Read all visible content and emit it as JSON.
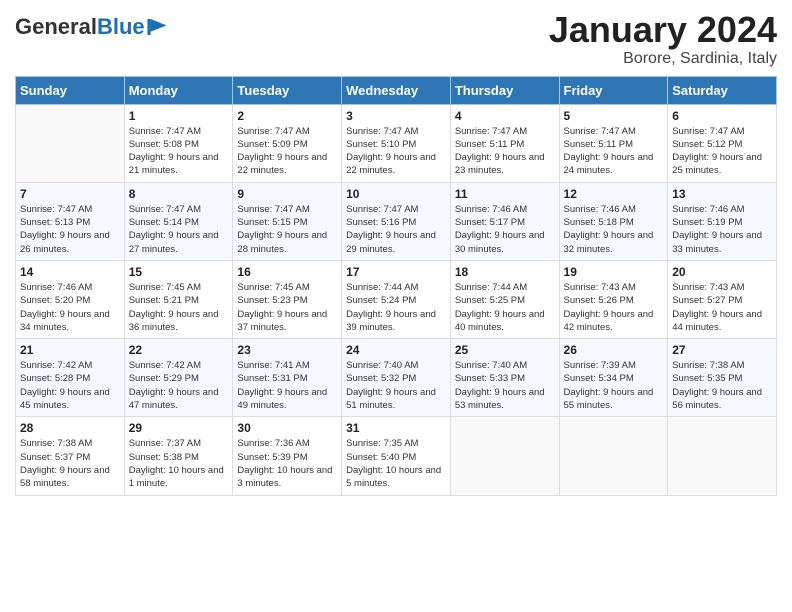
{
  "header": {
    "logo_general": "General",
    "logo_blue": "Blue",
    "month_title": "January 2024",
    "subtitle": "Borore, Sardinia, Italy"
  },
  "days_of_week": [
    "Sunday",
    "Monday",
    "Tuesday",
    "Wednesday",
    "Thursday",
    "Friday",
    "Saturday"
  ],
  "weeks": [
    [
      {
        "day": "",
        "sunrise": "",
        "sunset": "",
        "daylight": ""
      },
      {
        "day": "1",
        "sunrise": "Sunrise: 7:47 AM",
        "sunset": "Sunset: 5:08 PM",
        "daylight": "Daylight: 9 hours and 21 minutes."
      },
      {
        "day": "2",
        "sunrise": "Sunrise: 7:47 AM",
        "sunset": "Sunset: 5:09 PM",
        "daylight": "Daylight: 9 hours and 22 minutes."
      },
      {
        "day": "3",
        "sunrise": "Sunrise: 7:47 AM",
        "sunset": "Sunset: 5:10 PM",
        "daylight": "Daylight: 9 hours and 22 minutes."
      },
      {
        "day": "4",
        "sunrise": "Sunrise: 7:47 AM",
        "sunset": "Sunset: 5:11 PM",
        "daylight": "Daylight: 9 hours and 23 minutes."
      },
      {
        "day": "5",
        "sunrise": "Sunrise: 7:47 AM",
        "sunset": "Sunset: 5:11 PM",
        "daylight": "Daylight: 9 hours and 24 minutes."
      },
      {
        "day": "6",
        "sunrise": "Sunrise: 7:47 AM",
        "sunset": "Sunset: 5:12 PM",
        "daylight": "Daylight: 9 hours and 25 minutes."
      }
    ],
    [
      {
        "day": "7",
        "sunrise": "Sunrise: 7:47 AM",
        "sunset": "Sunset: 5:13 PM",
        "daylight": "Daylight: 9 hours and 26 minutes."
      },
      {
        "day": "8",
        "sunrise": "Sunrise: 7:47 AM",
        "sunset": "Sunset: 5:14 PM",
        "daylight": "Daylight: 9 hours and 27 minutes."
      },
      {
        "day": "9",
        "sunrise": "Sunrise: 7:47 AM",
        "sunset": "Sunset: 5:15 PM",
        "daylight": "Daylight: 9 hours and 28 minutes."
      },
      {
        "day": "10",
        "sunrise": "Sunrise: 7:47 AM",
        "sunset": "Sunset: 5:16 PM",
        "daylight": "Daylight: 9 hours and 29 minutes."
      },
      {
        "day": "11",
        "sunrise": "Sunrise: 7:46 AM",
        "sunset": "Sunset: 5:17 PM",
        "daylight": "Daylight: 9 hours and 30 minutes."
      },
      {
        "day": "12",
        "sunrise": "Sunrise: 7:46 AM",
        "sunset": "Sunset: 5:18 PM",
        "daylight": "Daylight: 9 hours and 32 minutes."
      },
      {
        "day": "13",
        "sunrise": "Sunrise: 7:46 AM",
        "sunset": "Sunset: 5:19 PM",
        "daylight": "Daylight: 9 hours and 33 minutes."
      }
    ],
    [
      {
        "day": "14",
        "sunrise": "Sunrise: 7:46 AM",
        "sunset": "Sunset: 5:20 PM",
        "daylight": "Daylight: 9 hours and 34 minutes."
      },
      {
        "day": "15",
        "sunrise": "Sunrise: 7:45 AM",
        "sunset": "Sunset: 5:21 PM",
        "daylight": "Daylight: 9 hours and 36 minutes."
      },
      {
        "day": "16",
        "sunrise": "Sunrise: 7:45 AM",
        "sunset": "Sunset: 5:23 PM",
        "daylight": "Daylight: 9 hours and 37 minutes."
      },
      {
        "day": "17",
        "sunrise": "Sunrise: 7:44 AM",
        "sunset": "Sunset: 5:24 PM",
        "daylight": "Daylight: 9 hours and 39 minutes."
      },
      {
        "day": "18",
        "sunrise": "Sunrise: 7:44 AM",
        "sunset": "Sunset: 5:25 PM",
        "daylight": "Daylight: 9 hours and 40 minutes."
      },
      {
        "day": "19",
        "sunrise": "Sunrise: 7:43 AM",
        "sunset": "Sunset: 5:26 PM",
        "daylight": "Daylight: 9 hours and 42 minutes."
      },
      {
        "day": "20",
        "sunrise": "Sunrise: 7:43 AM",
        "sunset": "Sunset: 5:27 PM",
        "daylight": "Daylight: 9 hours and 44 minutes."
      }
    ],
    [
      {
        "day": "21",
        "sunrise": "Sunrise: 7:42 AM",
        "sunset": "Sunset: 5:28 PM",
        "daylight": "Daylight: 9 hours and 45 minutes."
      },
      {
        "day": "22",
        "sunrise": "Sunrise: 7:42 AM",
        "sunset": "Sunset: 5:29 PM",
        "daylight": "Daylight: 9 hours and 47 minutes."
      },
      {
        "day": "23",
        "sunrise": "Sunrise: 7:41 AM",
        "sunset": "Sunset: 5:31 PM",
        "daylight": "Daylight: 9 hours and 49 minutes."
      },
      {
        "day": "24",
        "sunrise": "Sunrise: 7:40 AM",
        "sunset": "Sunset: 5:32 PM",
        "daylight": "Daylight: 9 hours and 51 minutes."
      },
      {
        "day": "25",
        "sunrise": "Sunrise: 7:40 AM",
        "sunset": "Sunset: 5:33 PM",
        "daylight": "Daylight: 9 hours and 53 minutes."
      },
      {
        "day": "26",
        "sunrise": "Sunrise: 7:39 AM",
        "sunset": "Sunset: 5:34 PM",
        "daylight": "Daylight: 9 hours and 55 minutes."
      },
      {
        "day": "27",
        "sunrise": "Sunrise: 7:38 AM",
        "sunset": "Sunset: 5:35 PM",
        "daylight": "Daylight: 9 hours and 56 minutes."
      }
    ],
    [
      {
        "day": "28",
        "sunrise": "Sunrise: 7:38 AM",
        "sunset": "Sunset: 5:37 PM",
        "daylight": "Daylight: 9 hours and 58 minutes."
      },
      {
        "day": "29",
        "sunrise": "Sunrise: 7:37 AM",
        "sunset": "Sunset: 5:38 PM",
        "daylight": "Daylight: 10 hours and 1 minute."
      },
      {
        "day": "30",
        "sunrise": "Sunrise: 7:36 AM",
        "sunset": "Sunset: 5:39 PM",
        "daylight": "Daylight: 10 hours and 3 minutes."
      },
      {
        "day": "31",
        "sunrise": "Sunrise: 7:35 AM",
        "sunset": "Sunset: 5:40 PM",
        "daylight": "Daylight: 10 hours and 5 minutes."
      },
      {
        "day": "",
        "sunrise": "",
        "sunset": "",
        "daylight": ""
      },
      {
        "day": "",
        "sunrise": "",
        "sunset": "",
        "daylight": ""
      },
      {
        "day": "",
        "sunrise": "",
        "sunset": "",
        "daylight": ""
      }
    ]
  ]
}
